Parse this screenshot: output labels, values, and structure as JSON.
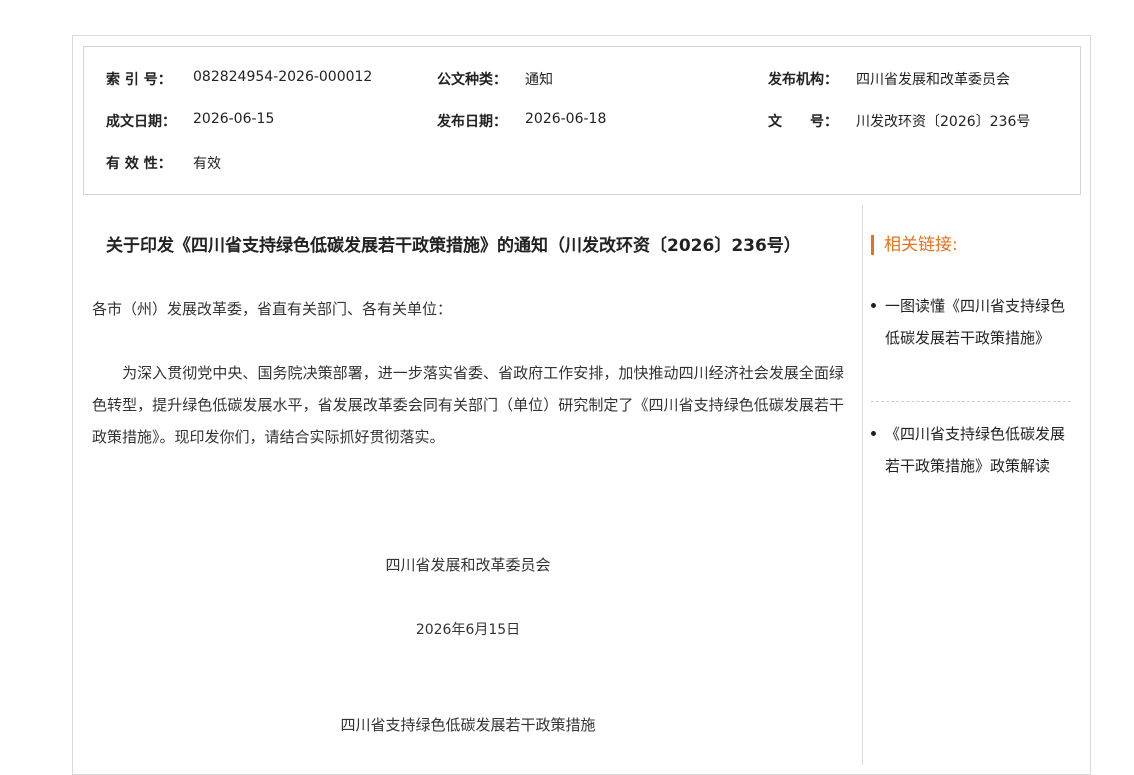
{
  "meta": {
    "index_label": "索 引 号：",
    "index_value": "082824954-2026-000012",
    "type_label": "公文种类：",
    "type_value": "通知",
    "org_label": "发布机构：",
    "org_value": "四川省发展和改革委员会",
    "written_label": "成文日期：",
    "written_value": "2026-06-15",
    "published_label": "发布日期：",
    "published_value": "2026-06-18",
    "docno_label": "文　　号：",
    "docno_value": "川发改环资〔2026〕236号",
    "validity_label": "有 效 性：",
    "validity_value": "有效"
  },
  "article": {
    "title": "关于印发《四川省支持绿色低碳发展若干政策措施》的通知（川发改环资〔2026〕236号）",
    "salutation": "各市（州）发展改革委，省直有关部门、各有关单位：",
    "body": "　　为深入贯彻党中央、国务院决策部署，进一步落实省委、省政府工作安排，加快推动四川经济社会发展全面绿色转型，提升绿色低碳发展水平，省发展改革委会同有关部门（单位）研究制定了《四川省支持绿色低碳发展若干政策措施》。现印发你们，请结合实际抓好贯彻落实。",
    "signature": "四川省发展和改革委员会",
    "date": "2026年6月15日",
    "attachment_title": "四川省支持绿色低碳发展若干政策措施"
  },
  "sidebar": {
    "title": "相关链接:",
    "links": [
      {
        "label": "一图读懂《四川省支持绿色低碳发展若干政策措施》"
      },
      {
        "label": "《四川省支持绿色低碳发展若干政策措施》政策解读"
      }
    ],
    "accent_color": "#e8711b"
  }
}
